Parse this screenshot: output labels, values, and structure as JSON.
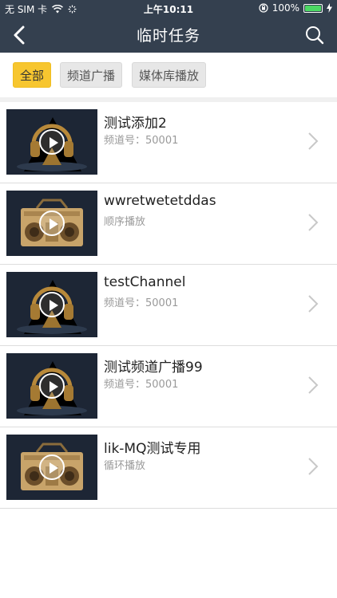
{
  "status_bar": {
    "carrier": "无 SIM 卡",
    "time": "上午10:11",
    "battery_percent": "100%",
    "battery_level": 1.0,
    "icons": [
      "wifi-icon",
      "loading-icon",
      "orientation-lock-icon",
      "battery-icon",
      "charging-icon"
    ]
  },
  "header": {
    "title": "临时任务",
    "icons": [
      "back-icon",
      "search-icon"
    ]
  },
  "tabs": [
    {
      "label": "全部",
      "active": true
    },
    {
      "label": "频道广播",
      "active": false
    },
    {
      "label": "媒体库播放",
      "active": false
    }
  ],
  "items": [
    {
      "title": "测试添加2",
      "subtitle": "频道号：50001",
      "thumbnail": "headphones-thumbnail"
    },
    {
      "title": "wwretwetetddas",
      "subtitle": "顺序播放",
      "thumbnail": "boombox-thumbnail"
    },
    {
      "title": "testChannel",
      "subtitle": "频道号：50001",
      "thumbnail": "headphones-thumbnail"
    },
    {
      "title": "测试频道广播99",
      "subtitle": "频道号：50001",
      "thumbnail": "headphones-thumbnail"
    },
    {
      "title": "lik-MQ测试专用",
      "subtitle": "循环播放",
      "thumbnail": "boombox-thumbnail"
    }
  ],
  "colors": {
    "header_bg": "#34404f",
    "active_tab": "#f7c62f",
    "battery_green": "#4cd964",
    "thumbnail_bg": "#1d2635"
  }
}
